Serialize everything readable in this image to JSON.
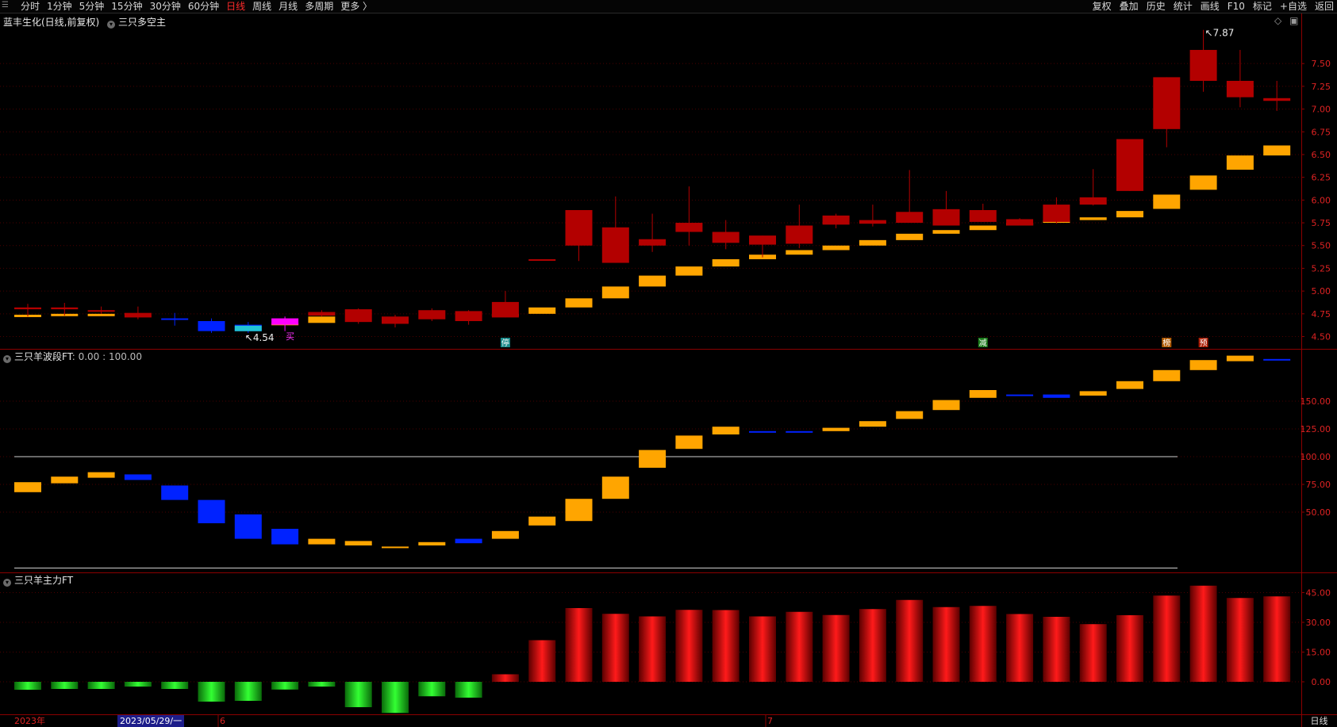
{
  "toolbar": {
    "periods": [
      "分时",
      "1分钟",
      "5分钟",
      "15分钟",
      "30分钟",
      "60分钟",
      "日线",
      "周线",
      "月线",
      "多周期",
      "更多 〉"
    ],
    "active_period": "日线",
    "right_tools": [
      "复权",
      "叠加",
      "历史",
      "统计",
      "画线",
      "F10",
      "标记",
      "+自选",
      "返回"
    ]
  },
  "main_panel": {
    "title": "蓝丰生化(日线,前复权)",
    "indicator": "三只多空主"
  },
  "sub_panel1": {
    "title": "三只羊波段FT",
    "params": ": 0.00 : 100.00"
  },
  "sub_panel2": {
    "title": "三只羊主力FT"
  },
  "timeline": {
    "year_label": "2023年",
    "cursor_date": "2023/05/29/一",
    "month_6": "6",
    "month_7": "7"
  },
  "period_label": "日线",
  "chart_data": [
    {
      "type": "candlestick",
      "ylim": [
        4.4,
        7.85
      ],
      "yticks": [
        4.5,
        4.75,
        5.0,
        5.25,
        5.5,
        5.75,
        6.0,
        6.25,
        6.5,
        6.75,
        7.0,
        7.25,
        7.5
      ],
      "annotations": {
        "high": "7.87",
        "low": "4.54"
      },
      "ohlc": [
        [
          4.82,
          4.8,
          4.86,
          4.72
        ],
        [
          4.8,
          4.82,
          4.87,
          4.73
        ],
        [
          4.78,
          4.79,
          4.83,
          4.75
        ],
        [
          4.76,
          4.71,
          4.83,
          4.69
        ],
        [
          4.7,
          4.69,
          4.76,
          4.62
        ],
        [
          4.67,
          4.56,
          4.7,
          4.54
        ],
        [
          4.56,
          4.63,
          4.66,
          4.54
        ],
        [
          4.63,
          4.7,
          4.72,
          4.56
        ],
        [
          4.73,
          4.77,
          4.79,
          4.72
        ],
        [
          4.8,
          4.66,
          4.81,
          4.64
        ],
        [
          4.72,
          4.64,
          4.74,
          4.6
        ],
        [
          4.79,
          4.69,
          4.81,
          4.67
        ],
        [
          4.78,
          4.67,
          4.79,
          4.63
        ],
        [
          4.88,
          4.71,
          5.0,
          4.71
        ],
        [
          5.35,
          5.35,
          5.35,
          5.35
        ],
        [
          5.89,
          5.5,
          5.89,
          5.33
        ],
        [
          5.7,
          5.31,
          6.04,
          5.31
        ],
        [
          5.57,
          5.5,
          5.85,
          5.43
        ],
        [
          5.75,
          5.65,
          6.15,
          5.5
        ],
        [
          5.65,
          5.53,
          5.78,
          5.46
        ],
        [
          5.61,
          5.51,
          5.61,
          5.37
        ],
        [
          5.72,
          5.52,
          5.95,
          5.47
        ],
        [
          5.83,
          5.73,
          5.85,
          5.69
        ],
        [
          5.78,
          5.74,
          5.95,
          5.71
        ],
        [
          5.87,
          5.75,
          6.33,
          5.75
        ],
        [
          5.9,
          5.72,
          6.1,
          5.72
        ],
        [
          5.89,
          5.76,
          5.96,
          5.76
        ],
        [
          5.79,
          5.72,
          5.8,
          5.72
        ],
        [
          5.95,
          5.76,
          6.03,
          5.74
        ],
        [
          6.03,
          5.95,
          6.34,
          5.94
        ],
        [
          6.67,
          6.1,
          6.67,
          6.1
        ],
        [
          7.35,
          6.78,
          7.35,
          6.58
        ],
        [
          7.65,
          7.31,
          7.87,
          7.19
        ],
        [
          7.31,
          7.13,
          7.65,
          7.02
        ],
        [
          7.12,
          7.09,
          7.31,
          6.98
        ]
      ],
      "support_line": [
        4.74,
        4.75,
        4.75,
        null,
        null,
        null,
        null,
        4.65,
        4.72,
        null,
        null,
        null,
        null,
        4.75,
        4.82,
        4.92,
        5.05,
        5.17,
        5.27,
        5.35,
        5.4,
        5.45,
        5.5,
        5.56,
        5.63,
        5.67,
        5.72,
        5.75,
        5.78,
        5.81,
        5.88,
        6.06,
        6.27,
        6.49,
        6.6
      ],
      "markers": [
        "停",
        "减",
        "榜",
        "预"
      ]
    },
    {
      "type": "bar",
      "ylim": [
        0,
        190
      ],
      "yticks": [
        50,
        75,
        100,
        125,
        150
      ],
      "reference_lines": [
        100
      ],
      "levels": [
        [
          77,
          68
        ],
        [
          82,
          76
        ],
        [
          86,
          81
        ],
        [
          84,
          79
        ],
        [
          74,
          61
        ],
        [
          61,
          40
        ],
        [
          48,
          26
        ],
        [
          35,
          21
        ],
        [
          26,
          21
        ],
        [
          24,
          20
        ],
        [
          19,
          18
        ],
        [
          23,
          20
        ],
        [
          26,
          22
        ],
        [
          33,
          26
        ],
        [
          46,
          38
        ],
        [
          62,
          42
        ],
        [
          82,
          62
        ],
        [
          106,
          90
        ],
        [
          119,
          107
        ],
        [
          127,
          120
        ],
        [
          123,
          122
        ],
        [
          123,
          122
        ],
        [
          126,
          123
        ],
        [
          132,
          127
        ],
        [
          141,
          134
        ],
        [
          151,
          142
        ],
        [
          160,
          153
        ],
        [
          156,
          155
        ],
        [
          156,
          153
        ],
        [
          159,
          155
        ],
        [
          168,
          161
        ],
        [
          178,
          168
        ],
        [
          187,
          178
        ],
        [
          191,
          186
        ],
        [
          188,
          187
        ]
      ]
    },
    {
      "type": "bar",
      "ylim": [
        -16,
        50
      ],
      "yticks": [
        0,
        15,
        30,
        45
      ],
      "values": [
        -4,
        -3.6,
        -3.6,
        -2.4,
        -3.6,
        -10,
        -9.6,
        -3.9,
        -2.4,
        -12.8,
        -15.7,
        -7.3,
        -8,
        3.8,
        21,
        37.2,
        34.3,
        33,
        36.3,
        36.2,
        33,
        35.3,
        33.7,
        36.7,
        41.3,
        37.7,
        38.3,
        34.2,
        32.8,
        29.1,
        33.6,
        43.5,
        48.5,
        42.3,
        43.1
      ]
    }
  ]
}
